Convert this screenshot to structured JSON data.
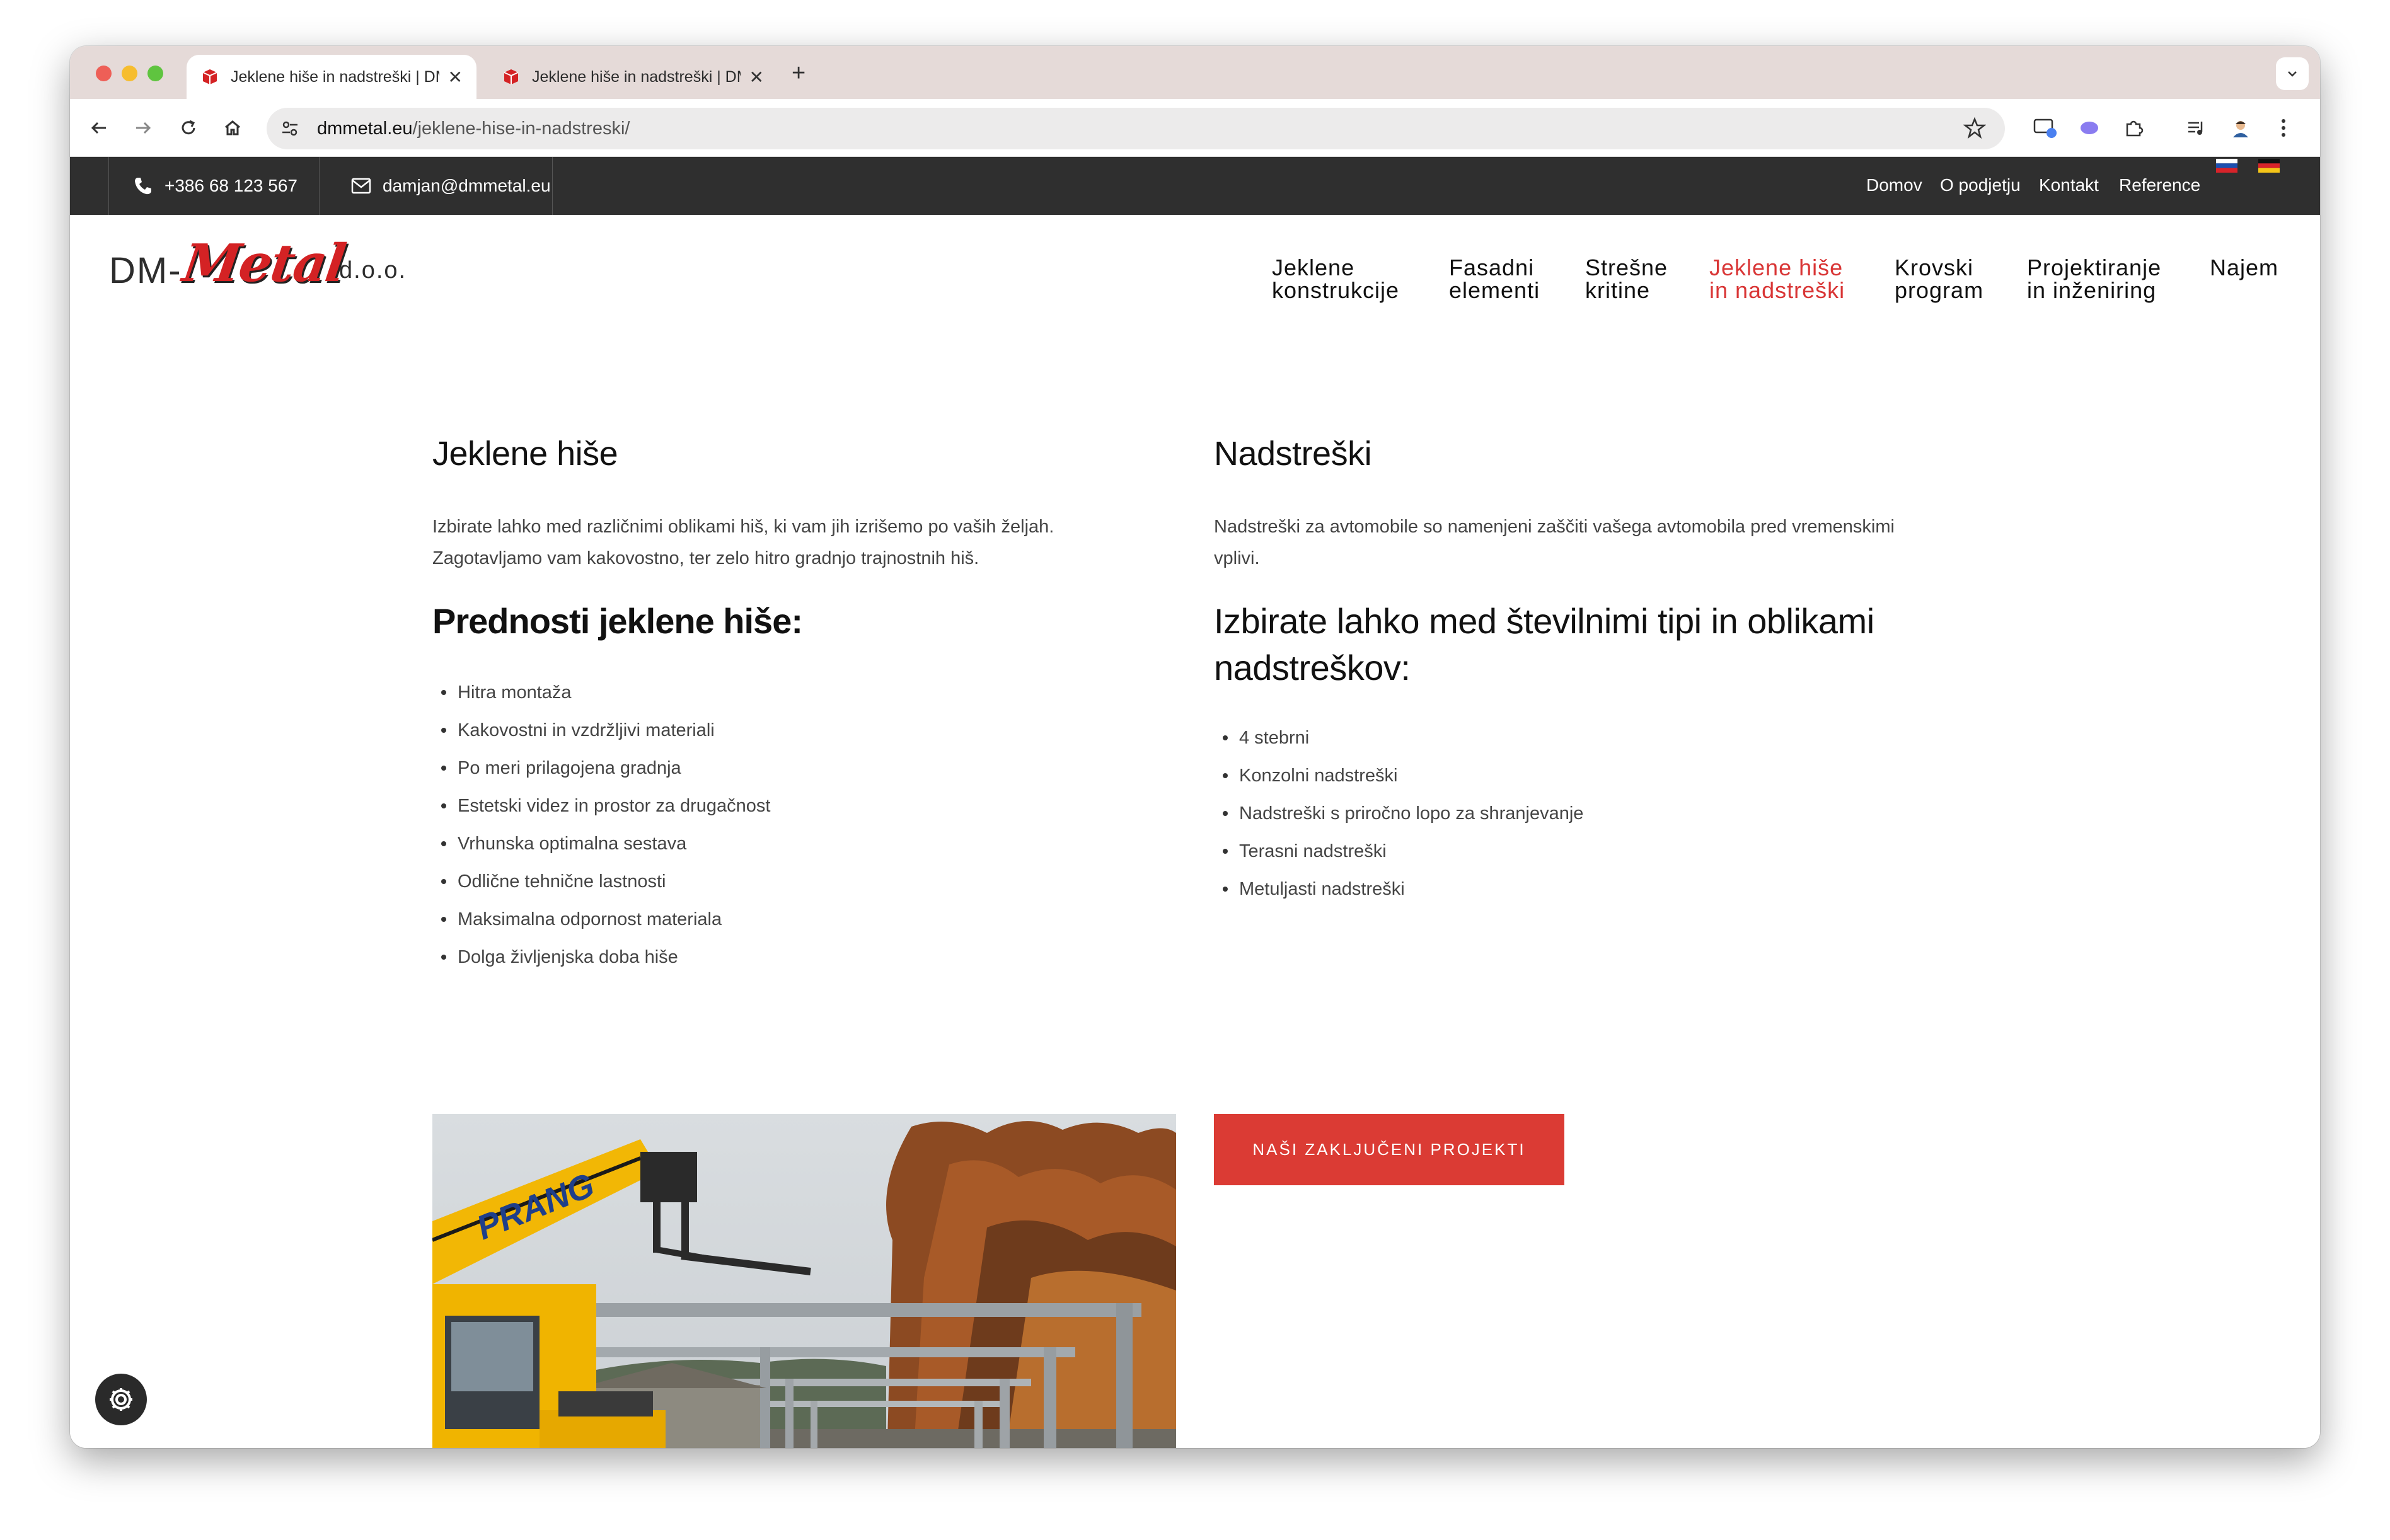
{
  "browser": {
    "tabs": [
      {
        "title": "Jeklene hiše in nadstreški | DM-Metal d.o.o.",
        "active": true
      },
      {
        "title": "Jeklene hiše in nadstreški | DM-Metal d.o.o.",
        "active": false
      }
    ],
    "url_host": "dmmetal.eu",
    "url_path": "/jeklene-hise-in-nadstreski/"
  },
  "topbar": {
    "phone": "+386 68 123 567",
    "email": "damjan@dmmetal.eu",
    "links": [
      "Domov",
      "O podjetju",
      "Kontakt",
      "Reference"
    ]
  },
  "logo": {
    "dm": "DM-",
    "metal": "Metal",
    "suffix": "d.o.o."
  },
  "nav": [
    {
      "line1": "Jeklene",
      "line2": "konstrukcije",
      "active": false
    },
    {
      "line1": "Fasadni",
      "line2": "elementi",
      "active": false
    },
    {
      "line1": "Strešne",
      "line2": "kritine",
      "active": false
    },
    {
      "line1": "Jeklene hiše",
      "line2": "in nadstreški",
      "active": true
    },
    {
      "line1": "Krovski",
      "line2": "program",
      "active": false
    },
    {
      "line1": "Projektiranje",
      "line2": "in inženiring",
      "active": false
    },
    {
      "line1": "Najem",
      "line2": "",
      "active": false
    }
  ],
  "left": {
    "title": "Jeklene hiše",
    "intro_line1": "Izbirate lahko med različnimi oblikami hiš, ki vam jih izrišemo po vaših željah.",
    "intro_line2": "Zagotavljamo vam kakovostno, ter zelo hitro gradnjo trajnostnih hiš.",
    "subtitle": "Prednosti jeklene hiše:",
    "items": [
      "Hitra montaža",
      "Kakovostni in vzdržljivi materiali",
      "Po meri prilagojena gradnja",
      "Estetski videz in prostor za drugačnost",
      "Vrhunska optimalna sestava",
      "Odlične tehnične lastnosti",
      "Maksimalna odpornost materiala",
      "Dolga življenjska doba hiše"
    ]
  },
  "right": {
    "title": "Nadstreški",
    "intro_line1": "Nadstreški za avtomobile so namenjeni zaščiti vašega avtomobila pred vremenskimi",
    "intro_line2": "vplivi.",
    "subtitle_line1": "Izbirate lahko med številnimi tipi in oblikami",
    "subtitle_line2": "nadstreškov:",
    "items": [
      "4 stebrni",
      "Konzolni nadstreški",
      "Nadstreški s priročno lopo za shranjevanje",
      "Terasni nadstreški",
      "Metuljasti nadstreški"
    ]
  },
  "cta": {
    "label": "NAŠI ZAKLJUČENI PROJEKTI"
  },
  "colors": {
    "accent": "#db3b34",
    "topbar": "#2f2f2f",
    "nav_active": "#d93636"
  }
}
